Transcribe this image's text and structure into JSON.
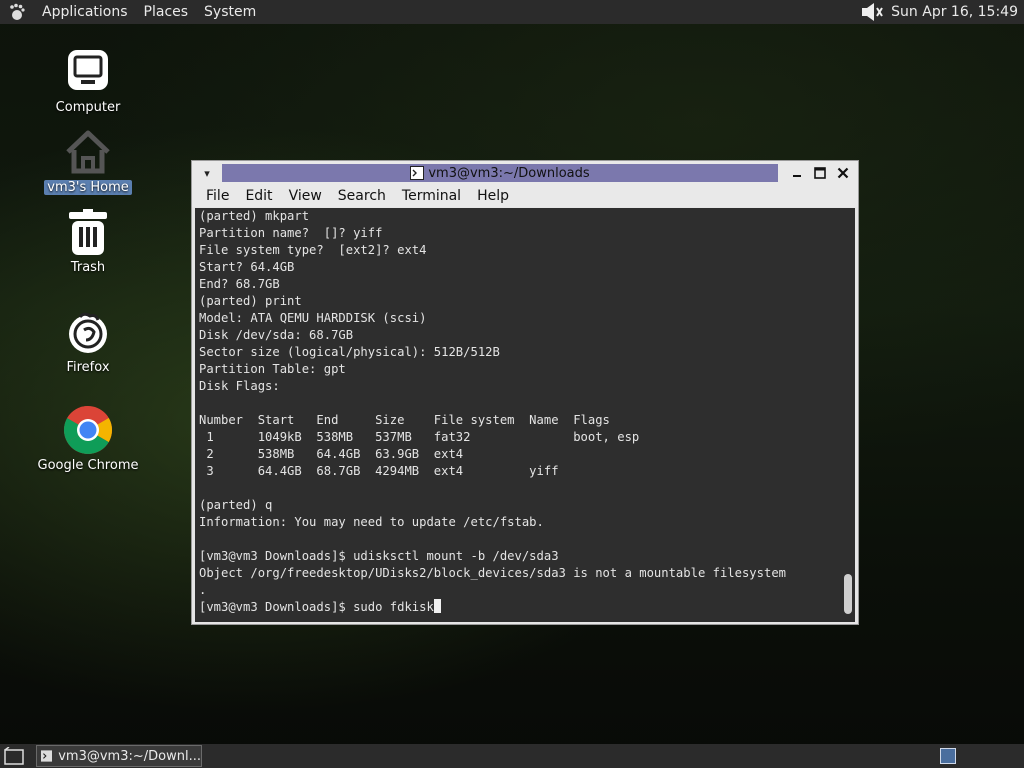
{
  "top_panel": {
    "menus": [
      "Applications",
      "Places",
      "System"
    ],
    "clock": "Sun Apr 16, 15:49"
  },
  "desktop_icons": [
    {
      "label": "Computer",
      "icon": "computer-icon"
    },
    {
      "label": "vm3's Home",
      "icon": "home-folder-icon"
    },
    {
      "label": "Trash",
      "icon": "trash-icon"
    },
    {
      "label": "Firefox",
      "icon": "firefox-icon"
    },
    {
      "label": "Google Chrome",
      "icon": "chrome-icon"
    }
  ],
  "window": {
    "title": "vm3@vm3:~/Downloads",
    "menus": [
      "File",
      "Edit",
      "View",
      "Search",
      "Terminal",
      "Help"
    ]
  },
  "terminal_lines": [
    "(parted) mkpart",
    "Partition name?  []? yiff",
    "File system type?  [ext2]? ext4",
    "Start? 64.4GB",
    "End? 68.7GB",
    "(parted) print",
    "Model: ATA QEMU HARDDISK (scsi)",
    "Disk /dev/sda: 68.7GB",
    "Sector size (logical/physical): 512B/512B",
    "Partition Table: gpt",
    "Disk Flags:",
    "",
    "Number  Start   End     Size    File system  Name  Flags",
    " 1      1049kB  538MB   537MB   fat32              boot, esp",
    " 2      538MB   64.4GB  63.9GB  ext4",
    " 3      64.4GB  68.7GB  4294MB  ext4         yiff",
    "",
    "(parted) q",
    "Information: You may need to update /etc/fstab.",
    "",
    "[vm3@vm3 Downloads]$ udisksctl mount -b /dev/sda3",
    "Object /org/freedesktop/UDisks2/block_devices/sda3 is not a mountable filesystem",
    "."
  ],
  "prompt_line": "[vm3@vm3 Downloads]$ sudo fdkisk",
  "taskbar": {
    "task_label": "vm3@vm3:~/Downl..."
  }
}
